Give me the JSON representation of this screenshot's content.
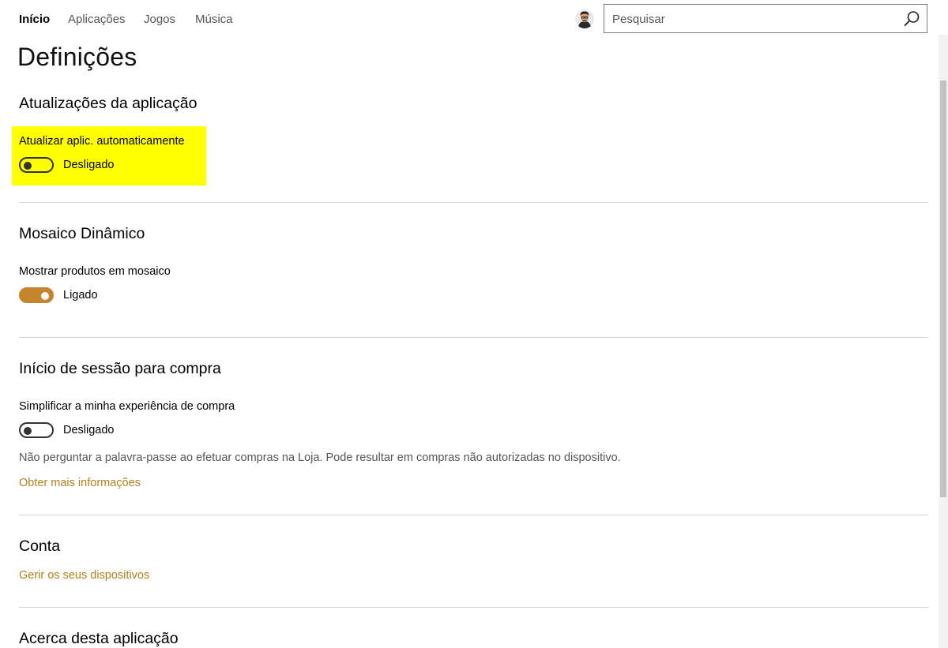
{
  "nav": {
    "tabs": [
      {
        "label": "Início",
        "active": true
      },
      {
        "label": "Aplicações",
        "active": false
      },
      {
        "label": "Jogos",
        "active": false
      },
      {
        "label": "Música",
        "active": false
      }
    ]
  },
  "search": {
    "placeholder": "Pesquisar",
    "value": "",
    "icon": "search-icon"
  },
  "page": {
    "title": "Definições"
  },
  "sections": {
    "app_updates": {
      "title": "Atualizações da aplicação",
      "setting_label": "Atualizar aplic. automaticamente",
      "toggle_state": "Desligado",
      "toggle_on": false,
      "highlight_color": "#ffff00"
    },
    "live_tile": {
      "title": "Mosaico Dinâmico",
      "setting_label": "Mostrar produtos em mosaico",
      "toggle_state": "Ligado",
      "toggle_on": true
    },
    "purchase_signin": {
      "title": "Início de sessão para compra",
      "setting_label": "Simplificar a minha experiência de compra",
      "toggle_state": "Desligado",
      "toggle_on": false,
      "description": "Não perguntar a palavra-passe ao efetuar compras na Loja. Pode resultar em compras não autorizadas no dispositivo.",
      "link": "Obter mais informações"
    },
    "account": {
      "title": "Conta",
      "link": "Gerir os seus dispositivos"
    },
    "about": {
      "title": "Acerca desta aplicação"
    }
  },
  "colors": {
    "accent": "#c5852c",
    "link": "#b47f1d",
    "divider": "#d6d6d6"
  }
}
